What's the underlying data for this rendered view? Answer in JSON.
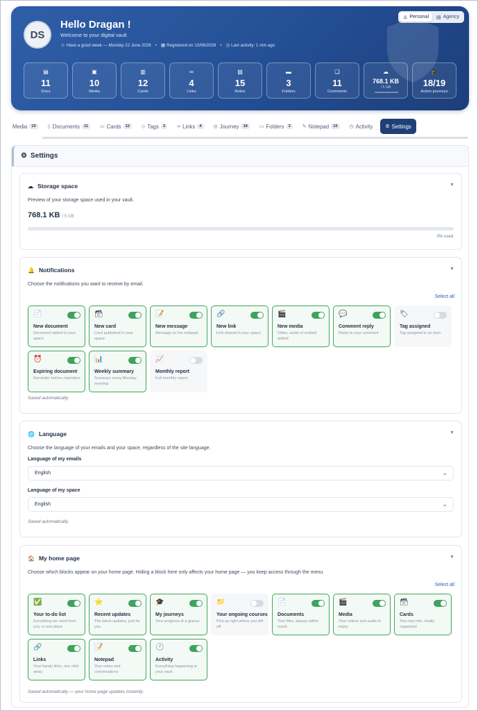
{
  "hero": {
    "avatar": "DS",
    "greeting": "Hello Dragan !",
    "subtitle": "Welcome to your digital vault",
    "meta": {
      "week": "Have a good week — Monday 22 June 2026",
      "registered": "Registered on 13/06/2026",
      "activity": "Last activity: 1 min ago"
    },
    "account_toggle": {
      "personal": "Personal",
      "agency": "Agency",
      "selected": "Personal"
    },
    "stats": [
      {
        "icon": "document-icon",
        "value": "11",
        "label": "Docs"
      },
      {
        "icon": "media-icon",
        "value": "10",
        "label": "Media"
      },
      {
        "icon": "cards-icon",
        "value": "12",
        "label": "Cards"
      },
      {
        "icon": "link-icon",
        "value": "4",
        "label": "Links"
      },
      {
        "icon": "notes-icon",
        "value": "15",
        "label": "Notes"
      },
      {
        "icon": "folder-icon",
        "value": "3",
        "label": "Folders"
      },
      {
        "icon": "comments-icon",
        "value": "11",
        "label": "Comments"
      },
      {
        "icon": "cloud-icon",
        "value": "768.1 KB",
        "sub": "/ 5 GB",
        "fill": 0
      },
      {
        "icon": "graduation-cap-icon",
        "value": "18/19",
        "label": "Active journeys"
      }
    ]
  },
  "tabs": [
    {
      "label": "Media",
      "count": "10",
      "icon": "media-icon"
    },
    {
      "label": "Documents",
      "count": "11",
      "icon": "document-icon"
    },
    {
      "label": "Cards",
      "count": "12",
      "icon": "cards-icon"
    },
    {
      "label": "Tags",
      "count": "3",
      "icon": "tag-icon"
    },
    {
      "label": "Links",
      "count": "4",
      "icon": "link-icon"
    },
    {
      "label": "Journey",
      "count": "18",
      "icon": "journey-icon"
    },
    {
      "label": "Folders",
      "count": "3",
      "icon": "folder-icon"
    },
    {
      "label": "Notepad",
      "count": "15",
      "icon": "notepad-icon"
    },
    {
      "label": "Activity",
      "icon": "activity-icon"
    },
    {
      "label": "Settings",
      "icon": "gear-icon",
      "active": true
    }
  ],
  "settings_title": "Settings",
  "storage": {
    "title": "Storage space",
    "desc": "Preview of your storage space used in your vault.",
    "used": "768.1 KB",
    "total": "/ 5 GB",
    "percent_text": "0% used",
    "fill": 0
  },
  "notifications": {
    "title": "Notifications",
    "desc": "Choose the notifications you want to receive by email.",
    "select_all": "Select all",
    "saved": "Saved automatically.",
    "items": [
      {
        "icon": "document-icon",
        "glyph": "📄",
        "name": "New document",
        "desc": "Document added to your space",
        "on": true
      },
      {
        "icon": "card-icon",
        "glyph": "🗃",
        "name": "New card",
        "desc": "Card published in your space",
        "on": true
      },
      {
        "icon": "message-icon",
        "glyph": "📝",
        "name": "New message",
        "desc": "Message on the notepad",
        "on": true
      },
      {
        "icon": "link-icon",
        "glyph": "🔗",
        "name": "New link",
        "desc": "Link shared in your space",
        "on": true
      },
      {
        "icon": "media-icon",
        "glyph": "🎬",
        "name": "New media",
        "desc": "Video, audio or embed added",
        "on": true
      },
      {
        "icon": "comment-icon",
        "glyph": "💬",
        "name": "Comment reply",
        "desc": "Reply to your comment",
        "on": true
      },
      {
        "icon": "tag-icon",
        "glyph": "🏷",
        "name": "Tag assigned",
        "desc": "Tag assigned to an item",
        "on": false
      },
      {
        "icon": "alarm-clock-icon",
        "glyph": "⏰",
        "name": "Expiring document",
        "desc": "Reminder before expiration",
        "on": true
      },
      {
        "icon": "bar-chart-icon",
        "glyph": "📊",
        "name": "Weekly summary",
        "desc": "Summary every Monday morning",
        "on": true
      },
      {
        "icon": "trend-chart-icon",
        "glyph": "📈",
        "name": "Monthly report",
        "desc": "Full monthly report",
        "on": false
      }
    ]
  },
  "language": {
    "title": "Language",
    "desc": "Choose the language of your emails and your space, regardless of the site language.",
    "emails_label": "Language of my emails",
    "emails_value": "English",
    "space_label": "Language of my space",
    "space_value": "English",
    "saved": "Saved automatically."
  },
  "homepage": {
    "title": "My home page",
    "desc": "Choose which blocks appear on your home page. Hiding a block here only affects your home page — you keep access through the menu.",
    "select_all": "Select all",
    "saved": "Saved automatically — your home page updates instantly.",
    "items": [
      {
        "icon": "checkbox-icon",
        "glyph": "✅",
        "name": "Your to-do list",
        "desc": "Everything we need from you, in one place",
        "on": true
      },
      {
        "icon": "star-icon",
        "glyph": "⭐",
        "name": "Recent updates",
        "desc": "The latest updates, just for you",
        "on": true
      },
      {
        "icon": "graduation-cap-icon",
        "glyph": "🎓",
        "name": "My journeys",
        "desc": "Your progress at a glance",
        "on": true
      },
      {
        "icon": "folder-icon",
        "glyph": "📁",
        "name": "Your ongoing courses",
        "desc": "Pick up right where you left off",
        "on": false
      },
      {
        "icon": "document-icon",
        "glyph": "📄",
        "name": "Documents",
        "desc": "Your files, always within reach",
        "on": true
      },
      {
        "icon": "media-icon",
        "glyph": "🎬",
        "name": "Media",
        "desc": "Your videos and audio to enjoy",
        "on": true
      },
      {
        "icon": "card-icon",
        "glyph": "🗃",
        "name": "Cards",
        "desc": "Your key info, neatly organized",
        "on": true
      },
      {
        "icon": "link-icon",
        "glyph": "🔗",
        "name": "Links",
        "desc": "Your handy links, one click away",
        "on": true
      },
      {
        "icon": "notepad-icon",
        "glyph": "📝",
        "name": "Notepad",
        "desc": "Your notes and conversations",
        "on": true
      },
      {
        "icon": "clock-icon",
        "glyph": "🕐",
        "name": "Activity",
        "desc": "Everything happening in your vault",
        "on": true
      }
    ]
  }
}
